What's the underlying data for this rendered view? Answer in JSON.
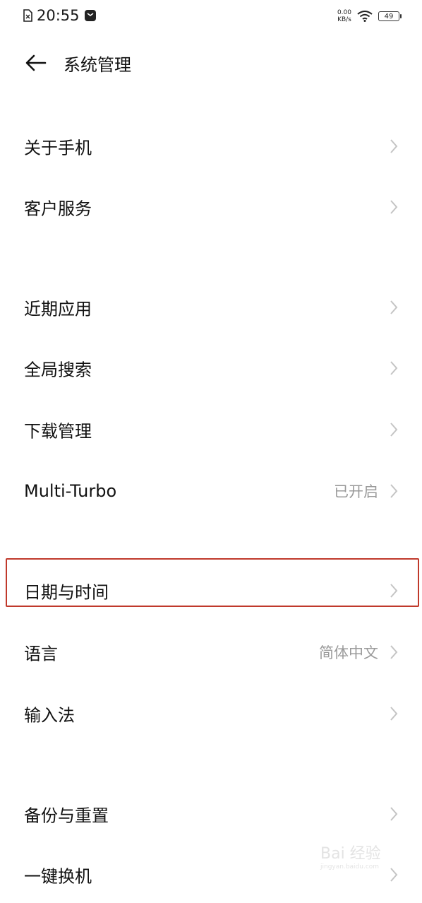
{
  "status_bar": {
    "time": "20:55",
    "net_speed_value": "0.00",
    "net_speed_unit": "KB/s",
    "battery": "49",
    "icons": [
      "sim-icon",
      "notification-icon",
      "wifi-icon",
      "battery-icon"
    ]
  },
  "header": {
    "title": "系统管理",
    "back_icon": "back-arrow-icon"
  },
  "rows": [
    {
      "label": "关于手机",
      "value": ""
    },
    {
      "label": "客户服务",
      "value": ""
    },
    {
      "label": "近期应用",
      "value": ""
    },
    {
      "label": "全局搜索",
      "value": ""
    },
    {
      "label": "下载管理",
      "value": ""
    },
    {
      "label": "Multi-Turbo",
      "value": "已开启"
    },
    {
      "label": "日期与时间",
      "value": ""
    },
    {
      "label": "语言",
      "value": "简体中文"
    },
    {
      "label": "输入法",
      "value": ""
    },
    {
      "label": "备份与重置",
      "value": ""
    },
    {
      "label": "一键换机",
      "value": ""
    }
  ],
  "highlight_color": "#c0392b",
  "watermark": {
    "text": "Bai 经验",
    "url": "jingyan.baidu.com"
  }
}
